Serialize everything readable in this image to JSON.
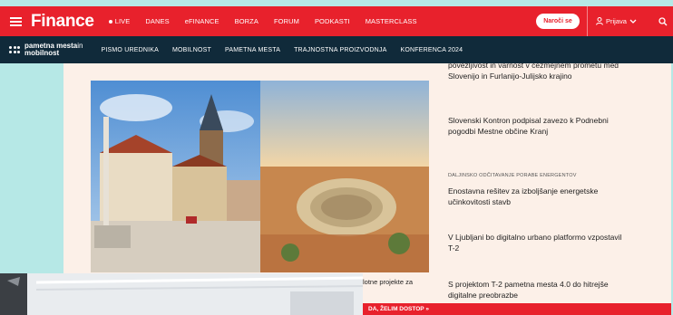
{
  "topnav": {
    "logo": "Finance",
    "items": [
      "LIVE",
      "DANES",
      "eFINANCE",
      "BORZA",
      "FORUM",
      "PODKASTI",
      "MASTERCLASS"
    ],
    "subscribe": "Naroči se",
    "login": "Prijava",
    "colors": {
      "brand": "#e8212c"
    }
  },
  "subnav": {
    "brand_main": "pametna mesta",
    "brand_in": "in",
    "brand_sub": "mobilnost",
    "items": [
      "PISMO UREDNIKA",
      "MOBILNOST",
      "PAMETNA MESTA",
      "TRAJNOSTNA PROIZVODNJA",
      "KONFERENCA 2024"
    ]
  },
  "sidebar": {
    "items": [
      {
        "text": "povezljivost in varnost v čezmejnem prometu med Slovenijo in Furlanijo-Julijsko krajino"
      },
      {
        "text": "Slovenski Kontron podpisal zavezo k Podnebni pogodbi Mestne občine Kranj"
      },
      {
        "tag": "DALJINSKO ODČITAVANJE PORABE ENERGENTOV",
        "text": "Enostavna rešitev za izboljšanje energetske učinkovitosti stavb"
      },
      {
        "text": "V Ljubljani bo digitalno urbano platformo vzpostavil T-2"
      },
      {
        "text": "S projektom T-2 pametna mesta 4.0 do hitrejše digitalne preobrazbe"
      }
    ]
  },
  "caption_fragment": "lotne projekte za",
  "paywall_cta": "DA, ŽELIM DOSTOP »"
}
